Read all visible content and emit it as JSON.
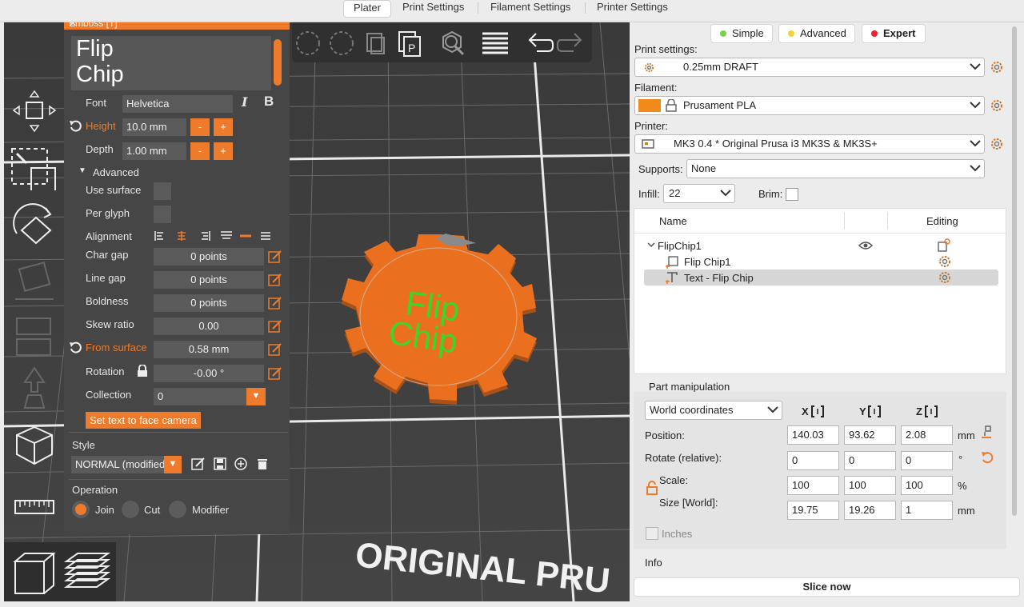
{
  "tabs": [
    {
      "label": "Plater",
      "active": true
    },
    {
      "label": "Print Settings",
      "active": false
    },
    {
      "label": "Filament Settings",
      "active": false
    },
    {
      "label": "Printer Settings",
      "active": false
    }
  ],
  "canvas": {
    "bed_label": "ORIGINAL PRU",
    "model_text_line1": "Flip",
    "model_text_line2": "Chip"
  },
  "top_toolbar": {
    "icons": [
      "add-icon",
      "delete-icon",
      "copy-icon",
      "paste-icon",
      "search-icon",
      "layers-icon",
      "undo-icon",
      "redo-icon"
    ]
  },
  "left_toolbar": {
    "icons": [
      "move-icon",
      "scale-icon",
      "rotate-icon",
      "place-on-face-icon",
      "cut-icon",
      "paint-supports-icon",
      "seam-paint-icon",
      "measure-icon"
    ]
  },
  "emboss": {
    "title": "Emboss [T]",
    "text_line1": "Flip",
    "text_line2": "Chip",
    "font_label": "Font",
    "font_value": "Helvetica",
    "height_label": "Height",
    "height_value": "10.0 mm",
    "depth_label": "Depth",
    "depth_value": "1.00 mm",
    "minus": "-",
    "plus": "+",
    "advanced_label": "Advanced",
    "use_surface_label": "Use surface",
    "per_glyph_label": "Per glyph",
    "alignment_label": "Alignment",
    "char_gap_label": "Char gap",
    "char_gap_value": "0 points",
    "line_gap_label": "Line gap",
    "line_gap_value": "0 points",
    "boldness_label": "Boldness",
    "boldness_value": "0 points",
    "skew_label": "Skew ratio",
    "skew_value": "0.00",
    "from_surface_label": "From surface",
    "from_surface_value": "0.58 mm",
    "rotation_label": "Rotation",
    "rotation_value": "-0.00 °",
    "collection_label": "Collection",
    "collection_value": "0",
    "face_camera_label": "Set text to face camera",
    "style_label": "Style",
    "style_value": "NORMAL (modified)",
    "operation_label": "Operation",
    "op_join": "Join",
    "op_cut": "Cut",
    "op_modifier": "Modifier",
    "accent": "#ee7a2b"
  },
  "sidebar": {
    "modes": [
      {
        "label": "Simple",
        "color": "#7bd34a"
      },
      {
        "label": "Advanced",
        "color": "#f2d33a"
      },
      {
        "label": "Expert",
        "color": "#e8262a"
      }
    ],
    "print_settings_label": "Print settings:",
    "print_settings_value": "0.25mm DRAFT",
    "filament_label": "Filament:",
    "filament_value": "Prusament PLA",
    "filament_color": "#f28a1b",
    "printer_label": "Printer:",
    "printer_value": "MK3 0.4 * Original Prusa i3 MK3S & MK3S+",
    "supports_label": "Supports:",
    "supports_value": "None",
    "infill_label": "Infill:",
    "infill_value": "22",
    "brim_label": "Brim:",
    "list_header_name": "Name",
    "list_header_editing": "Editing",
    "objects": [
      {
        "label": "FlipChip1",
        "level": 0
      },
      {
        "label": "Flip Chip1",
        "level": 1
      },
      {
        "label": "Text - Flip Chip",
        "level": 1,
        "selected": true
      }
    ],
    "part_manip_label": "Part manipulation",
    "coords_value": "World coordinates",
    "axis_x": "X",
    "axis_y": "Y",
    "axis_z": "Z",
    "position_label": "Position:",
    "position": [
      "140.03",
      "93.62",
      "2.08"
    ],
    "position_unit": "mm",
    "rotate_label": "Rotate (relative):",
    "rotate": [
      "0",
      "0",
      "0"
    ],
    "rotate_unit": "°",
    "scale_label": "Scale:",
    "scale": [
      "100",
      "100",
      "100"
    ],
    "scale_unit": "%",
    "size_label": "Size [World]:",
    "size": [
      "19.75",
      "19.26",
      "1"
    ],
    "size_unit": "mm",
    "inches_label": "Inches",
    "info_label": "Info",
    "slice_label": "Slice now"
  }
}
